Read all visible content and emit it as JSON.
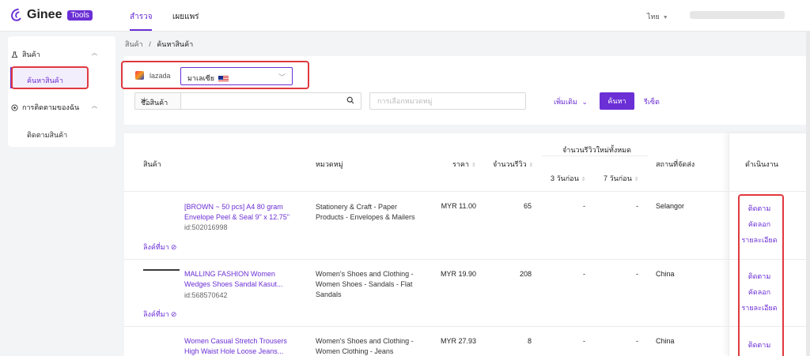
{
  "header": {
    "logo_text": "Ginee",
    "logo_badge": "Tools",
    "tabs": [
      {
        "label": "สำรวจ",
        "active": true
      },
      {
        "label": "เผยแพร่",
        "active": false
      }
    ],
    "language": "ไทย",
    "accent_color": "#6b2fd6"
  },
  "sidebar": {
    "groups": [
      {
        "label": "สินค้า",
        "icon": "flask-icon",
        "items": [
          "ค้นหาสินค้า"
        ]
      },
      {
        "label": "การติดตามของฉัน",
        "icon": "target-icon",
        "items": [
          "ติดตามสินค้า"
        ]
      }
    ]
  },
  "breadcrumb": {
    "parent": "สินค้า",
    "separator": "/",
    "current": "ค้นหาสินค้า"
  },
  "filters": {
    "platform": "lazada",
    "country": "มาเลเซีย",
    "field_select": "ชื่อสินค้า",
    "search_value": "",
    "category_placeholder": "การเลือกหมวดหมู่",
    "more_label": "เพิ่มเติม",
    "search_button": "ค้นหา",
    "reset_button": "รีเซ็ต"
  },
  "table": {
    "headers": {
      "product": "สินค้า",
      "category": "หมวดหมู่",
      "price": "ราคา",
      "reviews": "จำนวนรีวิว",
      "new_reviews_group": "จำนวนรีวิวใหม่ทั้งหมด",
      "reviews_3d": "3 วันก่อน",
      "reviews_7d": "7 วันก่อน",
      "ship_from": "สถานที่จัดส่ง",
      "actions": "ดำเนินงาน"
    },
    "origin_link_label": "ลิงค์ที่มา",
    "rows": [
      {
        "title": "[BROWN ~ 50 pcs] A4 80 gram Envelope Peel & Seal 9\" x 12.75\"",
        "id": "id:502016998",
        "category": "Stationery & Craft - Paper Products - Envelopes & Mailers",
        "price": "MYR 11.00",
        "reviews": "65",
        "reviews_3d": "-",
        "reviews_7d": "-",
        "ship_from": "Selangor",
        "actions": [
          "ติดตาม",
          "คัดลอก",
          "รายละเอียด"
        ]
      },
      {
        "title": "MALLING FASHION Women Wedges Shoes Sandal Kasut...",
        "id": "id:568570642",
        "category": "Women's Shoes and Clothing - Women Shoes - Sandals - Flat Sandals",
        "price": "MYR 19.90",
        "reviews": "208",
        "reviews_3d": "-",
        "reviews_7d": "-",
        "ship_from": "China",
        "actions": [
          "ติดตาม",
          "คัดลอก",
          "รายละเอียด"
        ]
      },
      {
        "title": "Women Casual Stretch Trousers High Waist Hole Loose Jeans...",
        "id": "",
        "category": "Women's Shoes and Clothing - Women Clothing - Jeans",
        "price": "MYR 27.93",
        "reviews": "8",
        "reviews_3d": "-",
        "reviews_7d": "-",
        "ship_from": "China",
        "actions": [
          "ติดตาม"
        ]
      }
    ]
  }
}
